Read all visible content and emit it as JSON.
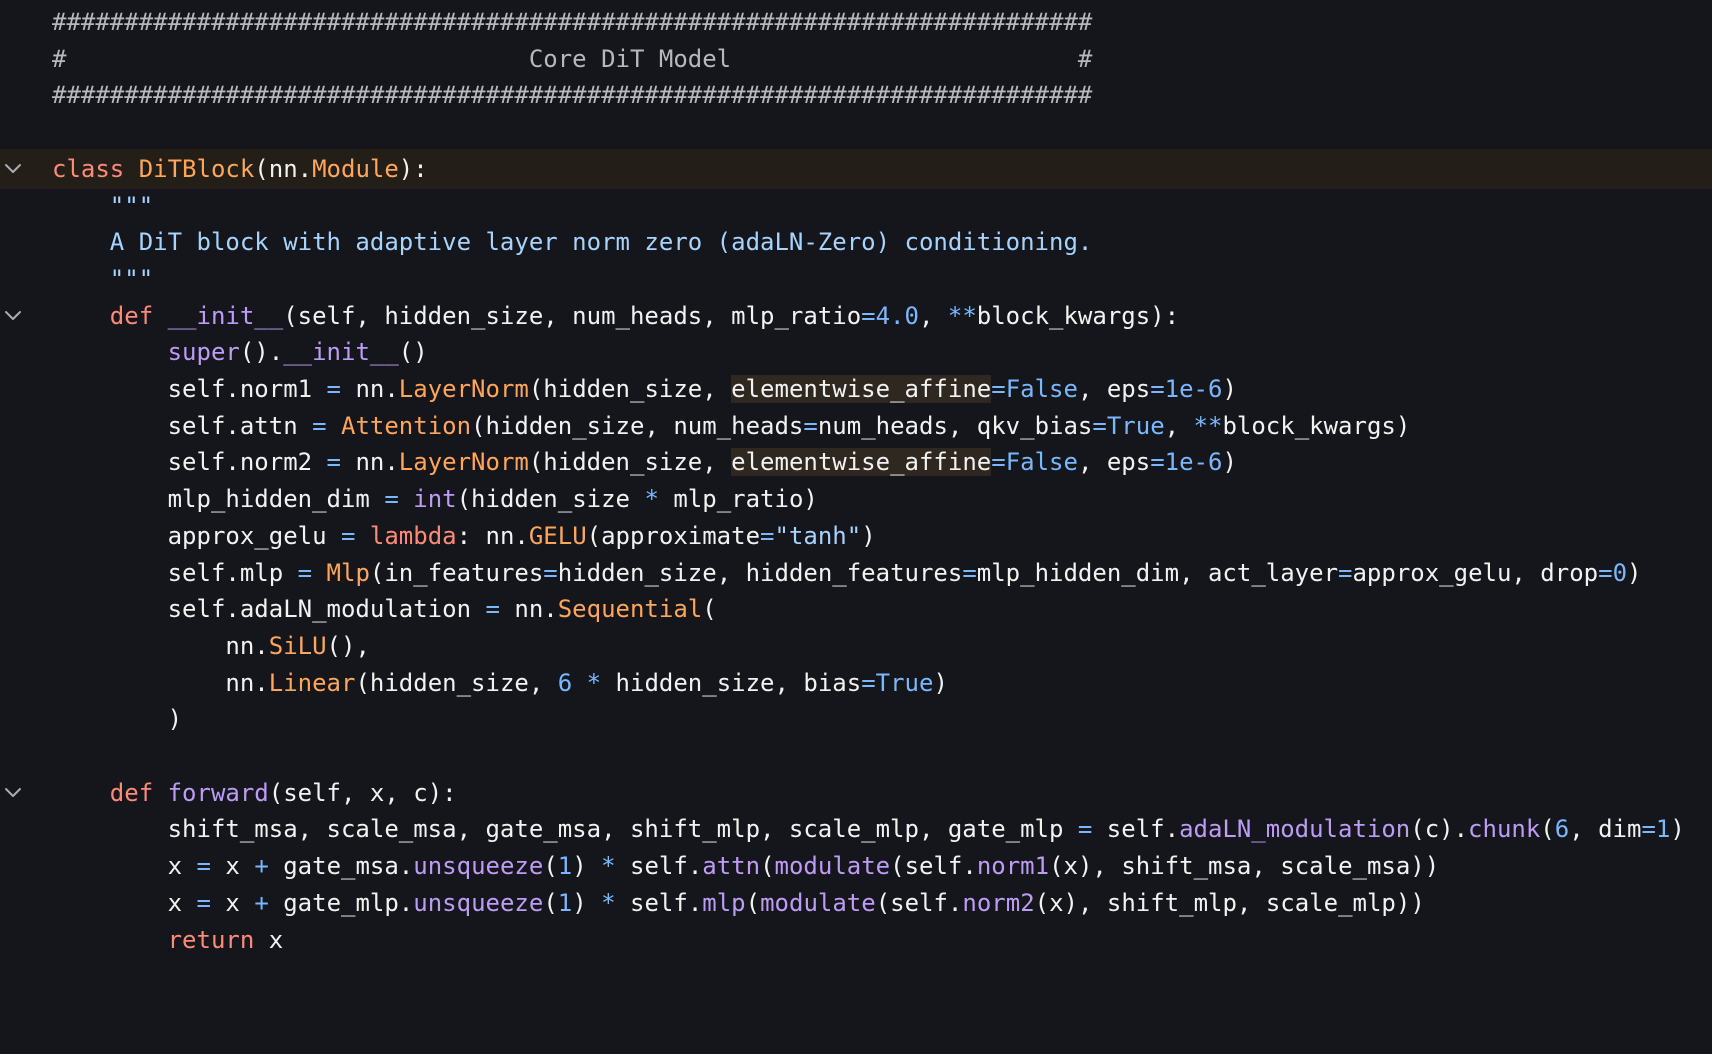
{
  "editor": {
    "lines": [
      {
        "fold": false,
        "current": false,
        "tokens": [
          [
            "comment",
            "########################################################################"
          ]
        ]
      },
      {
        "fold": false,
        "current": false,
        "tokens": [
          [
            "comment",
            "#                                Core DiT Model                        #"
          ]
        ]
      },
      {
        "fold": false,
        "current": false,
        "tokens": [
          [
            "comment",
            "########################################################################"
          ]
        ]
      },
      {
        "fold": false,
        "current": false,
        "tokens": []
      },
      {
        "fold": true,
        "current": true,
        "tokens": [
          [
            "kw",
            "class "
          ],
          [
            "cls",
            "DiTBlock"
          ],
          [
            "plain",
            "(nn."
          ],
          [
            "cls",
            "Module"
          ],
          [
            "plain",
            "):"
          ]
        ]
      },
      {
        "fold": false,
        "current": false,
        "tokens": [
          [
            "doc",
            "    \"\"\""
          ]
        ]
      },
      {
        "fold": false,
        "current": false,
        "tokens": [
          [
            "doc",
            "    A DiT block with adaptive layer norm zero (adaLN-Zero) conditioning."
          ]
        ]
      },
      {
        "fold": false,
        "current": false,
        "tokens": [
          [
            "doc",
            "    \"\"\""
          ]
        ]
      },
      {
        "fold": true,
        "current": false,
        "tokens": [
          [
            "plain",
            "    "
          ],
          [
            "kw",
            "def "
          ],
          [
            "fn",
            "__init__"
          ],
          [
            "plain",
            "(self, hidden_size, num_heads, mlp_ratio"
          ],
          [
            "op",
            "="
          ],
          [
            "num",
            "4.0"
          ],
          [
            "plain",
            ", "
          ],
          [
            "op",
            "**"
          ],
          [
            "plain",
            "block_kwargs):"
          ]
        ]
      },
      {
        "fold": false,
        "current": false,
        "tokens": [
          [
            "plain",
            "        "
          ],
          [
            "fn",
            "super"
          ],
          [
            "plain",
            "()."
          ],
          [
            "fn",
            "__init__"
          ],
          [
            "plain",
            "()"
          ]
        ]
      },
      {
        "fold": false,
        "current": false,
        "tokens": [
          [
            "plain",
            "        self.norm1 "
          ],
          [
            "op",
            "="
          ],
          [
            "plain",
            " nn."
          ],
          [
            "cls",
            "LayerNorm"
          ],
          [
            "plain",
            "(hidden_size, "
          ],
          [
            "hl",
            "elementwise_affine"
          ],
          [
            "op",
            "="
          ],
          [
            "num",
            "False"
          ],
          [
            "plain",
            ", eps"
          ],
          [
            "op",
            "="
          ],
          [
            "num",
            "1e-6"
          ],
          [
            "plain",
            ")"
          ]
        ]
      },
      {
        "fold": false,
        "current": false,
        "tokens": [
          [
            "plain",
            "        self.attn "
          ],
          [
            "op",
            "="
          ],
          [
            "plain",
            " "
          ],
          [
            "cls",
            "Attention"
          ],
          [
            "plain",
            "(hidden_size, num_heads"
          ],
          [
            "op",
            "="
          ],
          [
            "plain",
            "num_heads, qkv_bias"
          ],
          [
            "op",
            "="
          ],
          [
            "num",
            "True"
          ],
          [
            "plain",
            ", "
          ],
          [
            "op",
            "**"
          ],
          [
            "plain",
            "block_kwargs)"
          ]
        ]
      },
      {
        "fold": false,
        "current": false,
        "tokens": [
          [
            "plain",
            "        self.norm2 "
          ],
          [
            "op",
            "="
          ],
          [
            "plain",
            " nn."
          ],
          [
            "cls",
            "LayerNorm"
          ],
          [
            "plain",
            "(hidden_size, "
          ],
          [
            "hl",
            "elementwise_affine"
          ],
          [
            "op",
            "="
          ],
          [
            "num",
            "False"
          ],
          [
            "plain",
            ", eps"
          ],
          [
            "op",
            "="
          ],
          [
            "num",
            "1e-6"
          ],
          [
            "plain",
            ")"
          ]
        ]
      },
      {
        "fold": false,
        "current": false,
        "tokens": [
          [
            "plain",
            "        mlp_hidden_dim "
          ],
          [
            "op",
            "="
          ],
          [
            "plain",
            " "
          ],
          [
            "fn",
            "int"
          ],
          [
            "plain",
            "(hidden_size "
          ],
          [
            "op",
            "*"
          ],
          [
            "plain",
            " mlp_ratio)"
          ]
        ]
      },
      {
        "fold": false,
        "current": false,
        "tokens": [
          [
            "plain",
            "        approx_gelu "
          ],
          [
            "op",
            "="
          ],
          [
            "plain",
            " "
          ],
          [
            "kw",
            "lambda"
          ],
          [
            "plain",
            ": nn."
          ],
          [
            "cls",
            "GELU"
          ],
          [
            "plain",
            "(approximate"
          ],
          [
            "op",
            "="
          ],
          [
            "str",
            "\"tanh\""
          ],
          [
            "plain",
            ")"
          ]
        ]
      },
      {
        "fold": false,
        "current": false,
        "tokens": [
          [
            "plain",
            "        self.mlp "
          ],
          [
            "op",
            "="
          ],
          [
            "plain",
            " "
          ],
          [
            "cls",
            "Mlp"
          ],
          [
            "plain",
            "(in_features"
          ],
          [
            "op",
            "="
          ],
          [
            "plain",
            "hidden_size, hidden_features"
          ],
          [
            "op",
            "="
          ],
          [
            "plain",
            "mlp_hidden_dim, act_layer"
          ],
          [
            "op",
            "="
          ],
          [
            "plain",
            "approx_gelu, drop"
          ],
          [
            "op",
            "="
          ],
          [
            "num",
            "0"
          ],
          [
            "plain",
            ")"
          ]
        ]
      },
      {
        "fold": false,
        "current": false,
        "tokens": [
          [
            "plain",
            "        self.adaLN_modulation "
          ],
          [
            "op",
            "="
          ],
          [
            "plain",
            " nn."
          ],
          [
            "cls",
            "Sequential"
          ],
          [
            "plain",
            "("
          ]
        ]
      },
      {
        "fold": false,
        "current": false,
        "tokens": [
          [
            "plain",
            "            nn."
          ],
          [
            "cls",
            "SiLU"
          ],
          [
            "plain",
            "(),"
          ]
        ]
      },
      {
        "fold": false,
        "current": false,
        "tokens": [
          [
            "plain",
            "            nn."
          ],
          [
            "cls",
            "Linear"
          ],
          [
            "plain",
            "(hidden_size, "
          ],
          [
            "num",
            "6"
          ],
          [
            "plain",
            " "
          ],
          [
            "op",
            "*"
          ],
          [
            "plain",
            " hidden_size, bias"
          ],
          [
            "op",
            "="
          ],
          [
            "num",
            "True"
          ],
          [
            "plain",
            ")"
          ]
        ]
      },
      {
        "fold": false,
        "current": false,
        "tokens": [
          [
            "plain",
            "        )"
          ]
        ]
      },
      {
        "fold": false,
        "current": false,
        "tokens": []
      },
      {
        "fold": true,
        "current": false,
        "tokens": [
          [
            "plain",
            "    "
          ],
          [
            "kw",
            "def "
          ],
          [
            "fn",
            "forward"
          ],
          [
            "plain",
            "(self, x, c):"
          ]
        ]
      },
      {
        "fold": false,
        "current": false,
        "tokens": [
          [
            "plain",
            "        shift_msa, scale_msa, gate_msa, shift_mlp, scale_mlp, gate_mlp "
          ],
          [
            "op",
            "="
          ],
          [
            "plain",
            " self."
          ],
          [
            "fn",
            "adaLN_modulation"
          ],
          [
            "plain",
            "(c)."
          ],
          [
            "fn",
            "chunk"
          ],
          [
            "plain",
            "("
          ],
          [
            "num",
            "6"
          ],
          [
            "plain",
            ", dim"
          ],
          [
            "op",
            "="
          ],
          [
            "num",
            "1"
          ],
          [
            "plain",
            ")"
          ]
        ]
      },
      {
        "fold": false,
        "current": false,
        "tokens": [
          [
            "plain",
            "        x "
          ],
          [
            "op",
            "="
          ],
          [
            "plain",
            " x "
          ],
          [
            "op",
            "+"
          ],
          [
            "plain",
            " gate_msa."
          ],
          [
            "fn",
            "unsqueeze"
          ],
          [
            "plain",
            "("
          ],
          [
            "num",
            "1"
          ],
          [
            "plain",
            ") "
          ],
          [
            "op",
            "*"
          ],
          [
            "plain",
            " self."
          ],
          [
            "fn",
            "attn"
          ],
          [
            "plain",
            "("
          ],
          [
            "fn",
            "modulate"
          ],
          [
            "plain",
            "(self."
          ],
          [
            "fn",
            "norm1"
          ],
          [
            "plain",
            "(x), shift_msa, scale_msa))"
          ]
        ]
      },
      {
        "fold": false,
        "current": false,
        "tokens": [
          [
            "plain",
            "        x "
          ],
          [
            "op",
            "="
          ],
          [
            "plain",
            " x "
          ],
          [
            "op",
            "+"
          ],
          [
            "plain",
            " gate_mlp."
          ],
          [
            "fn",
            "unsqueeze"
          ],
          [
            "plain",
            "("
          ],
          [
            "num",
            "1"
          ],
          [
            "plain",
            ") "
          ],
          [
            "op",
            "*"
          ],
          [
            "plain",
            " self."
          ],
          [
            "fn",
            "mlp"
          ],
          [
            "plain",
            "("
          ],
          [
            "fn",
            "modulate"
          ],
          [
            "plain",
            "(self."
          ],
          [
            "fn",
            "norm2"
          ],
          [
            "plain",
            "(x), shift_mlp, scale_mlp))"
          ]
        ]
      },
      {
        "fold": false,
        "current": false,
        "tokens": [
          [
            "plain",
            "        "
          ],
          [
            "kw",
            "return"
          ],
          [
            "plain",
            " x"
          ]
        ]
      }
    ]
  }
}
